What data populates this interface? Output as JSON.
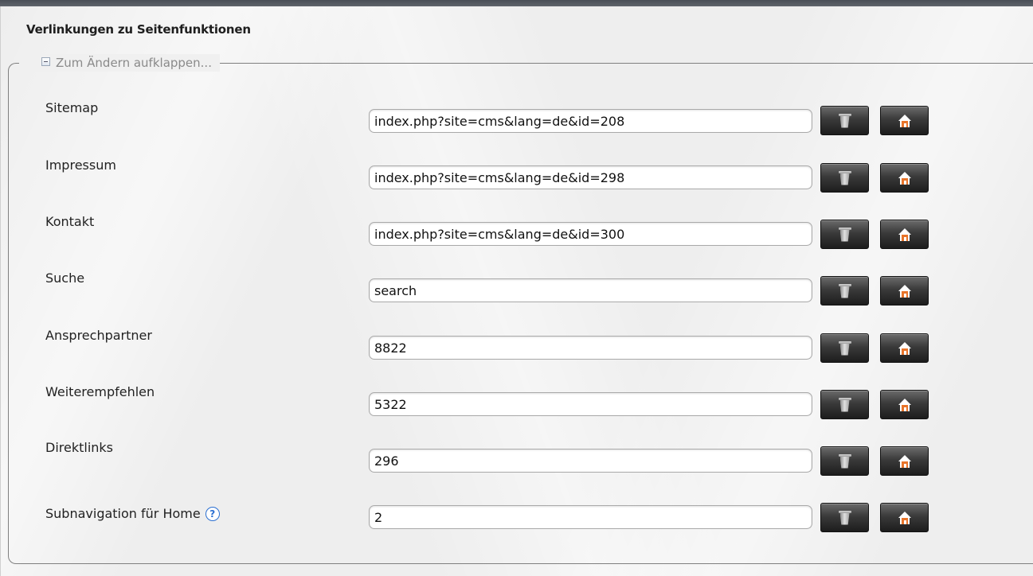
{
  "section": {
    "title": "Verlinkungen zu Seitenfunktionen"
  },
  "fieldset": {
    "legend": "Zum Ändern aufklappen..."
  },
  "rows": [
    {
      "label": "Sitemap",
      "value": "index.php?site=cms&lang=de&id=208"
    },
    {
      "label": "Impressum",
      "value": "index.php?site=cms&lang=de&id=298"
    },
    {
      "label": "Kontakt",
      "value": "index.php?site=cms&lang=de&id=300"
    },
    {
      "label": "Suche",
      "value": "search"
    },
    {
      "label": "Ansprechpartner",
      "value": "8822"
    },
    {
      "label": "Weiterempfehlen",
      "value": "5322"
    },
    {
      "label": "Direktlinks",
      "value": "296"
    },
    {
      "label": "Subnavigation für Home",
      "value": "2",
      "help": "?"
    }
  ],
  "icons": {
    "delete": "trash-icon",
    "home": "house-icon",
    "help": "help-icon",
    "collapse": "minus-box-icon"
  },
  "colors": {
    "button_dark": "#1d1d1d",
    "home_orange": "#e8742a",
    "help_blue": "#2a6fd1"
  }
}
